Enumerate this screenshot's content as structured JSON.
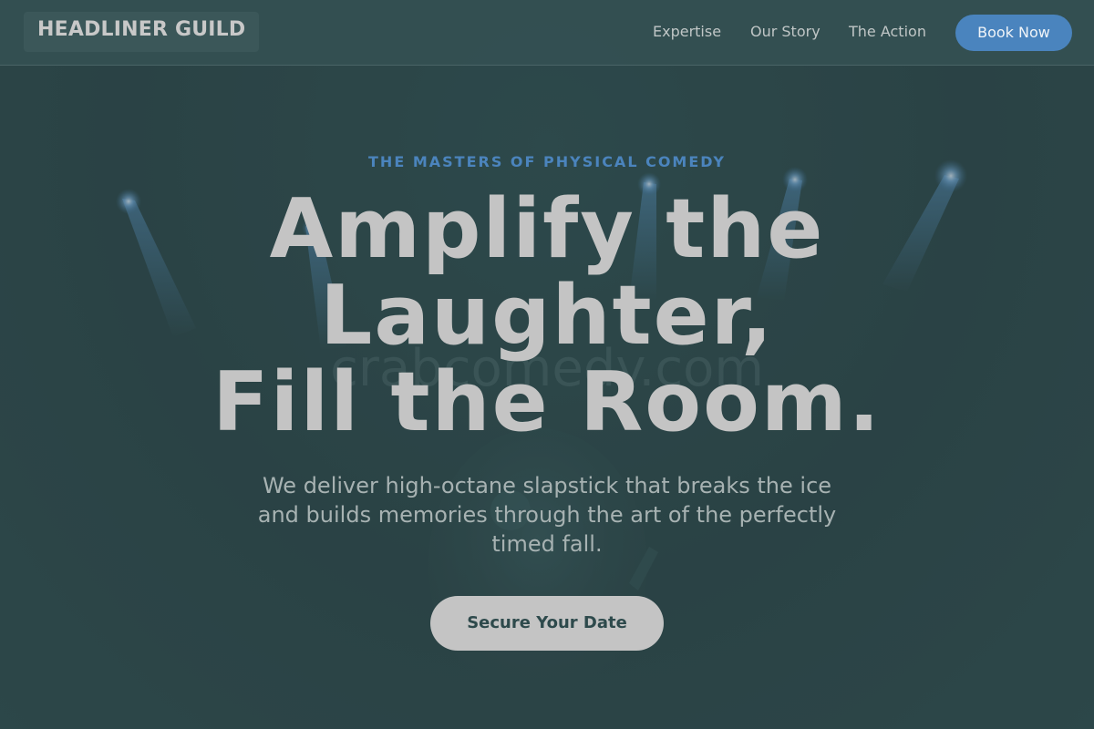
{
  "brand": {
    "name": "HEADLINER GUILD"
  },
  "nav": {
    "items": [
      {
        "label": "Expertise"
      },
      {
        "label": "Our Story"
      },
      {
        "label": "The Action"
      }
    ],
    "cta_label": "Book Now"
  },
  "hero": {
    "eyebrow": "THE MASTERS OF PHYSICAL COMEDY",
    "headline_lines": [
      "Amplify the",
      "Laughter,",
      "Fill the Room."
    ],
    "watermark": "crabcomedy.com",
    "subtext": "We deliver high-octane slapstick that breaks the ice and builds memories through the art of the perfectly timed fall.",
    "cta_label": "Secure Your Date",
    "background_image": "stage-spotlights-performer"
  },
  "colors": {
    "background": "#2b4547",
    "header": "#345052",
    "accent": "#4a84be",
    "headline": "#c4c4c4",
    "subtext": "#a7b2b2"
  }
}
